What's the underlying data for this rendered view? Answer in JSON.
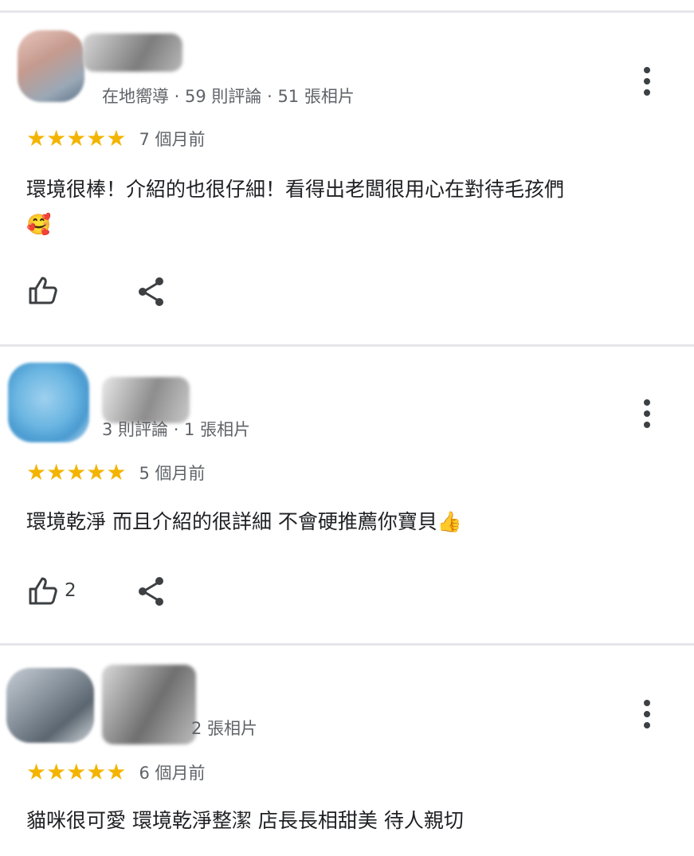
{
  "reviews": [
    {
      "meta": "在地嚮導 · 59 則評論 · 51 張相片",
      "rating": 5,
      "stars": "★★★★★",
      "time": "7 個月前",
      "text_line1": "環境很棒！介紹的也很仔細！看得出老闆很用心在對待毛孩們",
      "text_line2": "🥰",
      "likes": "",
      "like_icon": "thumbs-up-icon",
      "share_icon": "share-icon",
      "menu_icon": "more-vert-icon"
    },
    {
      "meta": "3 則評論 · 1 張相片",
      "rating": 5,
      "stars": "★★★★★",
      "time": "5 個月前",
      "text_line1": "環境乾淨 而且介紹的很詳細 不會硬推薦你寶貝👍",
      "likes": "2",
      "like_icon": "thumbs-up-icon",
      "share_icon": "share-icon",
      "menu_icon": "more-vert-icon"
    },
    {
      "meta": "2 張相片",
      "rating": 5,
      "stars": "★★★★★",
      "time": "6 個月前",
      "text_line1": "貓咪很可愛 環境乾淨整潔 店長長相甜美 待人親切",
      "menu_icon": "more-vert-icon"
    }
  ],
  "colors": {
    "star": "#f3b400",
    "meta_text": "#5f6368",
    "body_text": "#202124",
    "divider": "#e6e6ea"
  }
}
